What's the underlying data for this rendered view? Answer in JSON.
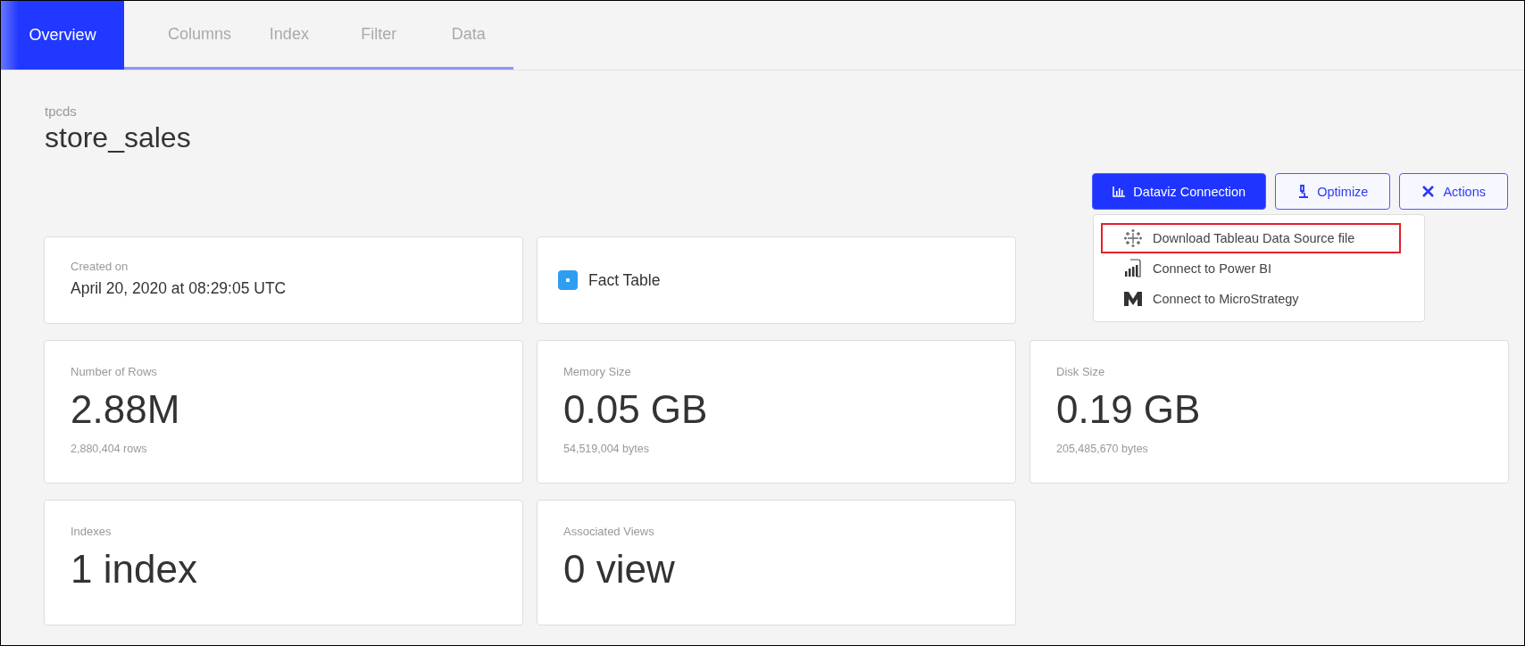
{
  "tabs": [
    {
      "label": "Overview",
      "selected": true
    },
    {
      "label": "Columns",
      "selected": false
    },
    {
      "label": "Index",
      "selected": false
    },
    {
      "label": "Filter",
      "selected": false
    },
    {
      "label": "Data",
      "selected": false
    }
  ],
  "header": {
    "schema": "tpcds",
    "table": "store_sales"
  },
  "buttons": [
    {
      "kind": "dataviz",
      "label": "Dataviz Connection",
      "primary": true
    },
    {
      "kind": "optimize",
      "label": "Optimize",
      "primary": false
    },
    {
      "kind": "actions",
      "label": "Actions",
      "primary": false
    }
  ],
  "dataviz_menu": [
    {
      "kind": "tableau",
      "label": "Download Tableau Data Source file",
      "highlighted": true
    },
    {
      "kind": "powerbi",
      "label": "Connect to Power BI",
      "highlighted": false
    },
    {
      "kind": "microstrategy",
      "label": "Connect to MicroStrategy",
      "highlighted": false
    }
  ],
  "created": {
    "label": "Created on",
    "value": "April 20, 2020 at 08:29:05 UTC"
  },
  "table_type": {
    "label": "Fact Table"
  },
  "stats": [
    {
      "label": "Number of Rows",
      "value": "2.88M",
      "detail": "2,880,404 rows"
    },
    {
      "label": "Memory Size",
      "value": "0.05 GB",
      "detail": "54,519,004 bytes"
    },
    {
      "label": "Disk Size",
      "value": "0.19 GB",
      "detail": "205,485,670 bytes"
    },
    {
      "label": "Indexes",
      "value": "1 index"
    },
    {
      "label": "Associated Views",
      "value": "0 view"
    }
  ]
}
